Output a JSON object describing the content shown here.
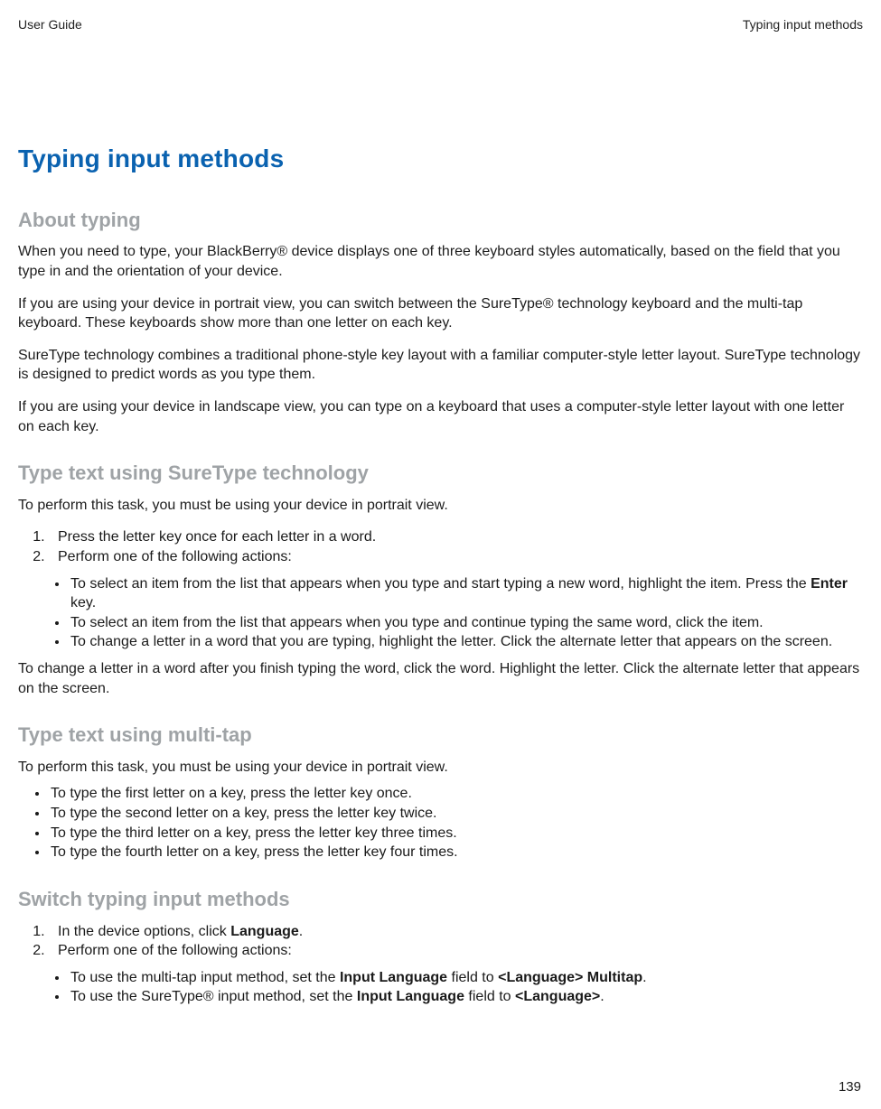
{
  "header": {
    "left": "User Guide",
    "right": "Typing input methods"
  },
  "title": "Typing input methods",
  "sections": {
    "about": {
      "heading": "About typing",
      "p1": "When you need to type, your BlackBerry® device displays one of three keyboard styles automatically, based on the field that you type in and the orientation of your device.",
      "p2": "If you are using your device in portrait view, you can switch between the SureType® technology keyboard and the multi-tap keyboard. These keyboards show more than one letter on each key.",
      "p3": "SureType technology combines a traditional phone-style key layout with a familiar computer-style letter layout. SureType technology is designed to predict words as you type them.",
      "p4": "If you are using your device in landscape view, you can type on a keyboard that uses a computer-style letter layout with one letter on each key."
    },
    "suretype": {
      "heading": "Type text using SureType technology",
      "intro": "To perform this task, you must be using your device in portrait view.",
      "step1": "Press the letter key once for each letter in a word.",
      "step2": "Perform one of the following actions:",
      "sub1_pre": "To select an item from the list that appears when you type and start typing a new word, highlight the item. Press the ",
      "sub1_bold": "Enter",
      "sub1_post": " key.",
      "sub2": "To select an item from the list that appears when you type and continue typing the same word, click the item.",
      "sub3": "To change a letter in a word that you are typing, highlight the letter. Click the alternate letter that appears on the screen.",
      "after": "To change a letter in a word after you finish typing the word, click the word. Highlight the letter. Click the alternate letter that appears on the screen."
    },
    "multitap": {
      "heading": "Type text using multi-tap",
      "intro": "To perform this task, you must be using your device in portrait view.",
      "b1": "To type the first letter on a key, press the letter key once.",
      "b2": "To type the second letter on a key, press the letter key twice.",
      "b3": "To type the third letter on a key, press the letter key three times.",
      "b4": "To type the fourth letter on a key, press the letter key four times."
    },
    "switch": {
      "heading": "Switch typing input methods",
      "s1_pre": "In the device options, click ",
      "s1_bold": "Language",
      "s1_post": ".",
      "s2": "Perform one of the following actions:",
      "sub1_pre": "To use the multi-tap input method, set the ",
      "sub1_b1": "Input Language",
      "sub1_mid": " field to ",
      "sub1_b2": "<Language> Multitap",
      "sub1_post": ".",
      "sub2_pre": "To use the SureType® input method, set the ",
      "sub2_b1": "Input Language",
      "sub2_mid": " field to ",
      "sub2_b2": "<Language>",
      "sub2_post": "."
    }
  },
  "pageNumber": "139"
}
